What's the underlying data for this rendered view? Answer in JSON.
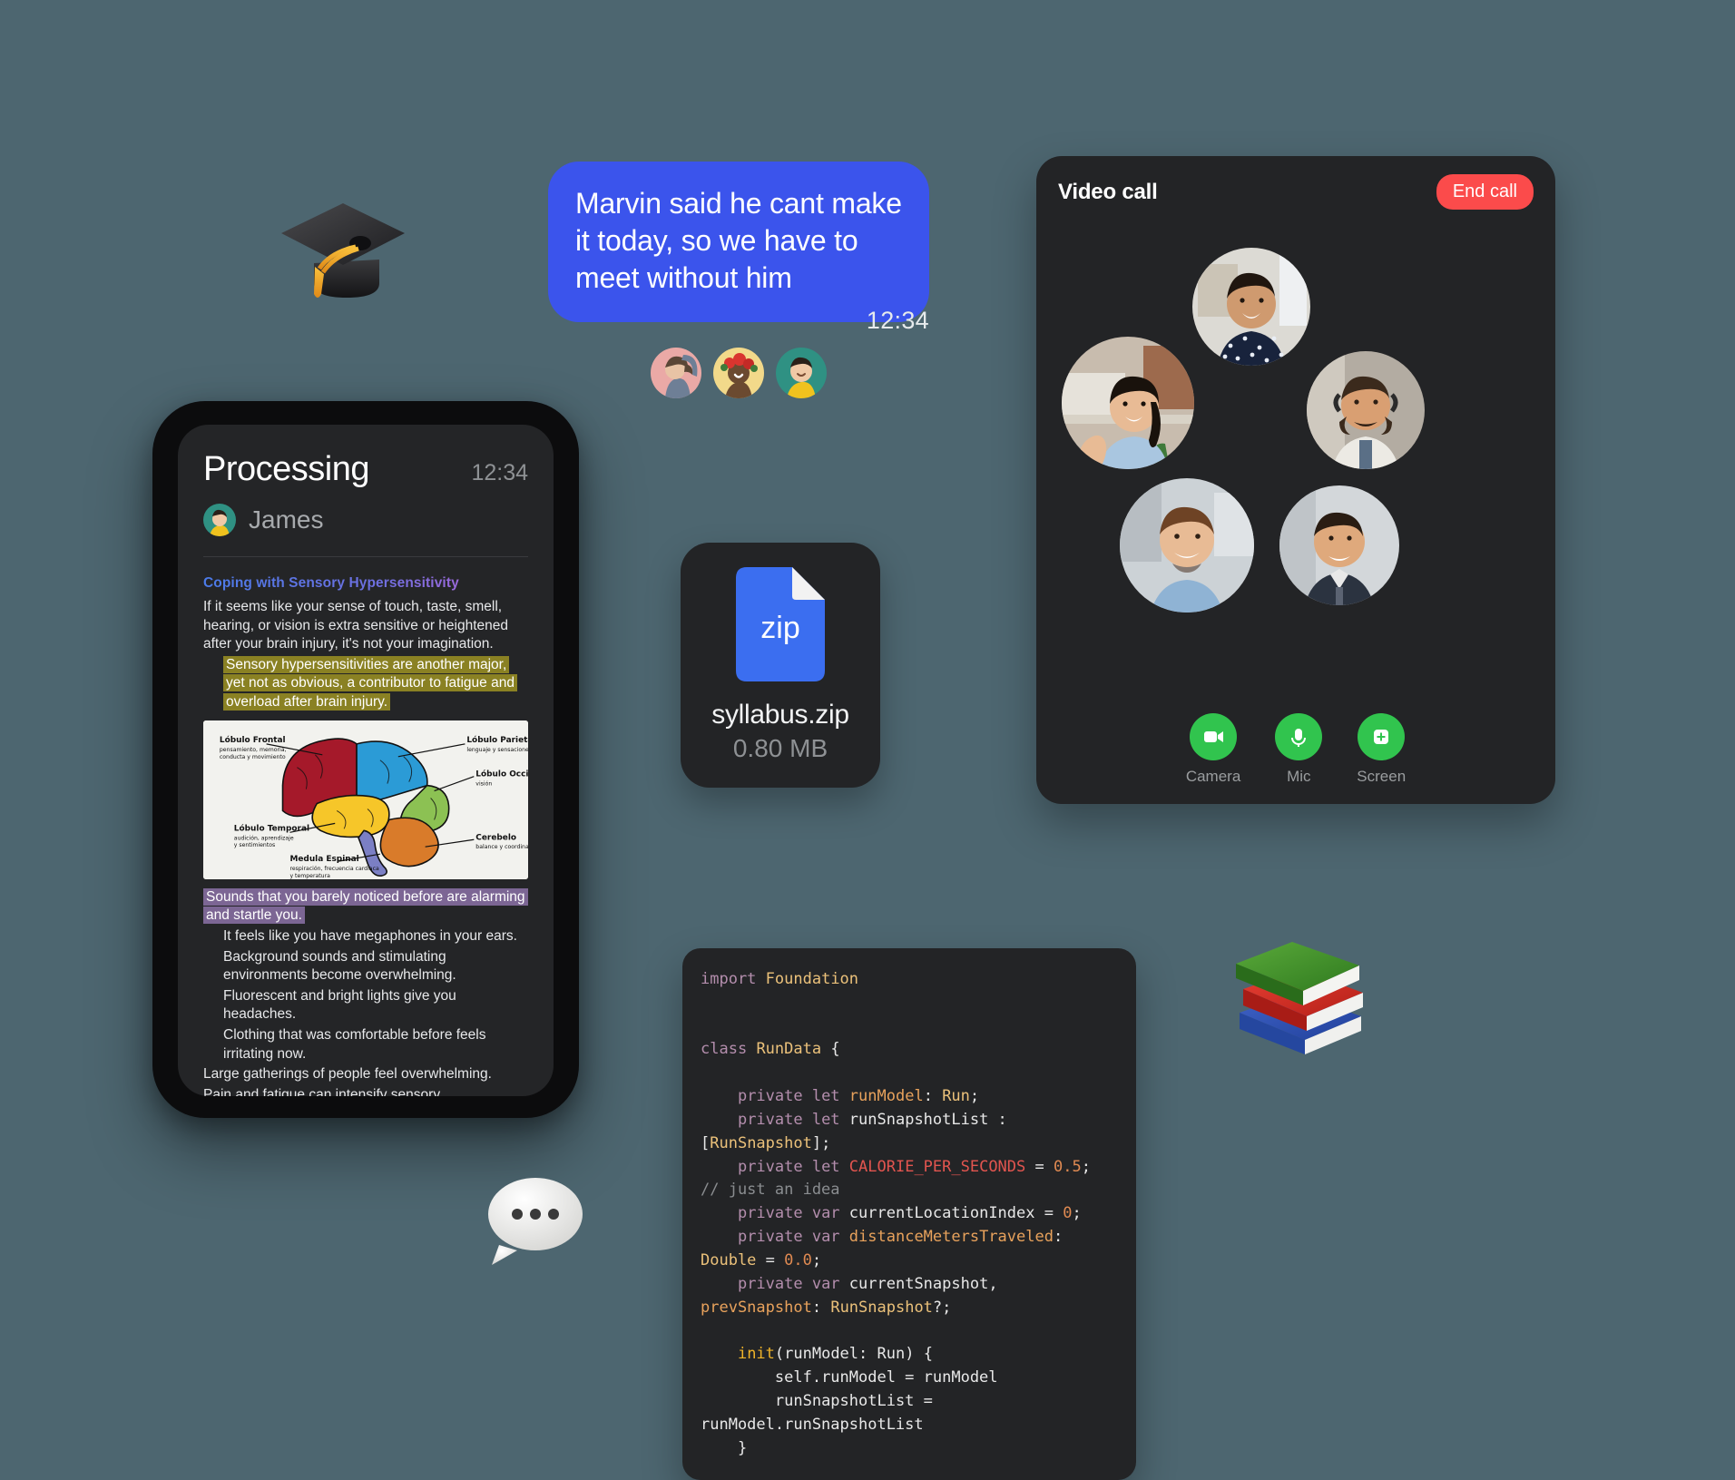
{
  "theme": {
    "background": "#4d6670",
    "bubble_blue": "#3b54ec",
    "card_dark": "#232426",
    "end_call_red": "#fb4b4b",
    "control_green": "#31c44e",
    "highlight_olive": "#8a8123",
    "highlight_purple": "#7c6694",
    "heading_gradient_from": "#4b7be9",
    "heading_gradient_to": "#c165d8"
  },
  "message": {
    "text": "Marvin said he cant make it today, so we have to meet without him",
    "time": "12:34",
    "reactors": [
      {
        "name": "avatar-person-1",
        "bg": "#eaa9a6"
      },
      {
        "name": "avatar-person-2",
        "bg": "#f2d98a"
      },
      {
        "name": "avatar-person-3",
        "bg": "#2f9183"
      }
    ]
  },
  "stickers": {
    "graduation_cap": "graduation-cap-emoji",
    "books": "books-emoji",
    "speech_balloon": "speech-balloon-emoji"
  },
  "phone": {
    "title": "Processing",
    "time": "12:34",
    "user": "James",
    "article": {
      "heading": "Coping with Sensory Hypersensitivity",
      "paragraph_1": "If it seems like your sense of touch, taste, smell, hearing, or vision is extra sensitive or heightened after your brain injury, it's not your imagination.",
      "highlight_olive": "Sensory hypersensitivities are another major, yet not as obvious, a contributor to fatigue and overload after brain injury.",
      "highlight_purple": "Sounds that you barely noticed before are alarming and startle you.",
      "bullets": [
        "It feels like you have megaphones in your ears.",
        "Background sounds and stimulating environments become overwhelming.",
        "Fluorescent and bright lights give you headaches.",
        "Clothing that was comfortable before feels irritating now."
      ],
      "paragraph_2": "Large gatherings of people feel overwhelming.",
      "paragraph_3": "Pain and fatigue can intensify sensory hypersensitivities,",
      "figure": {
        "alt": "brain-lobes-diagram",
        "labels": [
          {
            "title": "Lóbulo Frontal",
            "sub": "pensamiento, memoria, conducta y movimiento",
            "color": "#a5192a"
          },
          {
            "title": "Lóbulo Parietal",
            "sub": "lenguaje y sensaciones",
            "color": "#2b9bd6"
          },
          {
            "title": "Lóbulo Occipital",
            "sub": "visión",
            "color": "#8cc153"
          },
          {
            "title": "Lóbulo Temporal",
            "sub": "audición, aprendizaje y sentimientos",
            "color": "#f6c game"
          },
          {
            "title": "Cerebelo",
            "sub": "balance y coordinación",
            "color": "#d97b2a"
          },
          {
            "title": "Medula Espinal",
            "sub": "respiración, frecuencia cardiaca y temperatura",
            "color": "#7b7fc4"
          }
        ]
      }
    }
  },
  "zip": {
    "badge": "zip",
    "filename": "syllabus.zip",
    "size": "0.80 MB"
  },
  "video_call": {
    "title": "Video call",
    "end_call_label": "End call",
    "participants": [
      {
        "name": "participant-top",
        "skin": "#d9a57e",
        "shirt": "#1c2a44",
        "bg": "#d9d6cf"
      },
      {
        "name": "participant-left",
        "skin": "#e0b48c",
        "shirt": "#9fc0de",
        "bg": "#cfc6bb"
      },
      {
        "name": "participant-right",
        "skin": "#e0b089",
        "shirt": "#e8e4dc",
        "bg": "#b9b2a8"
      },
      {
        "name": "participant-bottom-left",
        "skin": "#e6b993",
        "shirt": "#8fb3d4",
        "bg": "#cdd3d6"
      },
      {
        "name": "participant-bottom-right",
        "skin": "#e3b085",
        "shirt": "#2b3340",
        "bg": "#cfd4d7"
      }
    ],
    "controls": [
      {
        "label": "Camera",
        "icon": "video-camera-icon"
      },
      {
        "label": "Mic",
        "icon": "microphone-icon"
      },
      {
        "label": "Screen",
        "icon": "share-screen-icon"
      }
    ]
  },
  "code": {
    "language": "swift",
    "lines": [
      "import Foundation",
      "",
      "",
      "class RunData {",
      "",
      "    private let runModel: Run;",
      "    private let runSnapshotList : [RunSnapshot];",
      "    private let CALORIE_PER_SECONDS = 0.5; // just an idea",
      "    private var currentLocationIndex = 0;",
      "    private var distanceMetersTraveled: Double = 0.0;",
      "    private var currentSnapshot, prevSnapshot: RunSnapshot?;",
      "",
      "    init(runModel: Run) {",
      "        self.runModel = runModel",
      "        runSnapshotList = runModel.runSnapshotList",
      "    }"
    ]
  }
}
